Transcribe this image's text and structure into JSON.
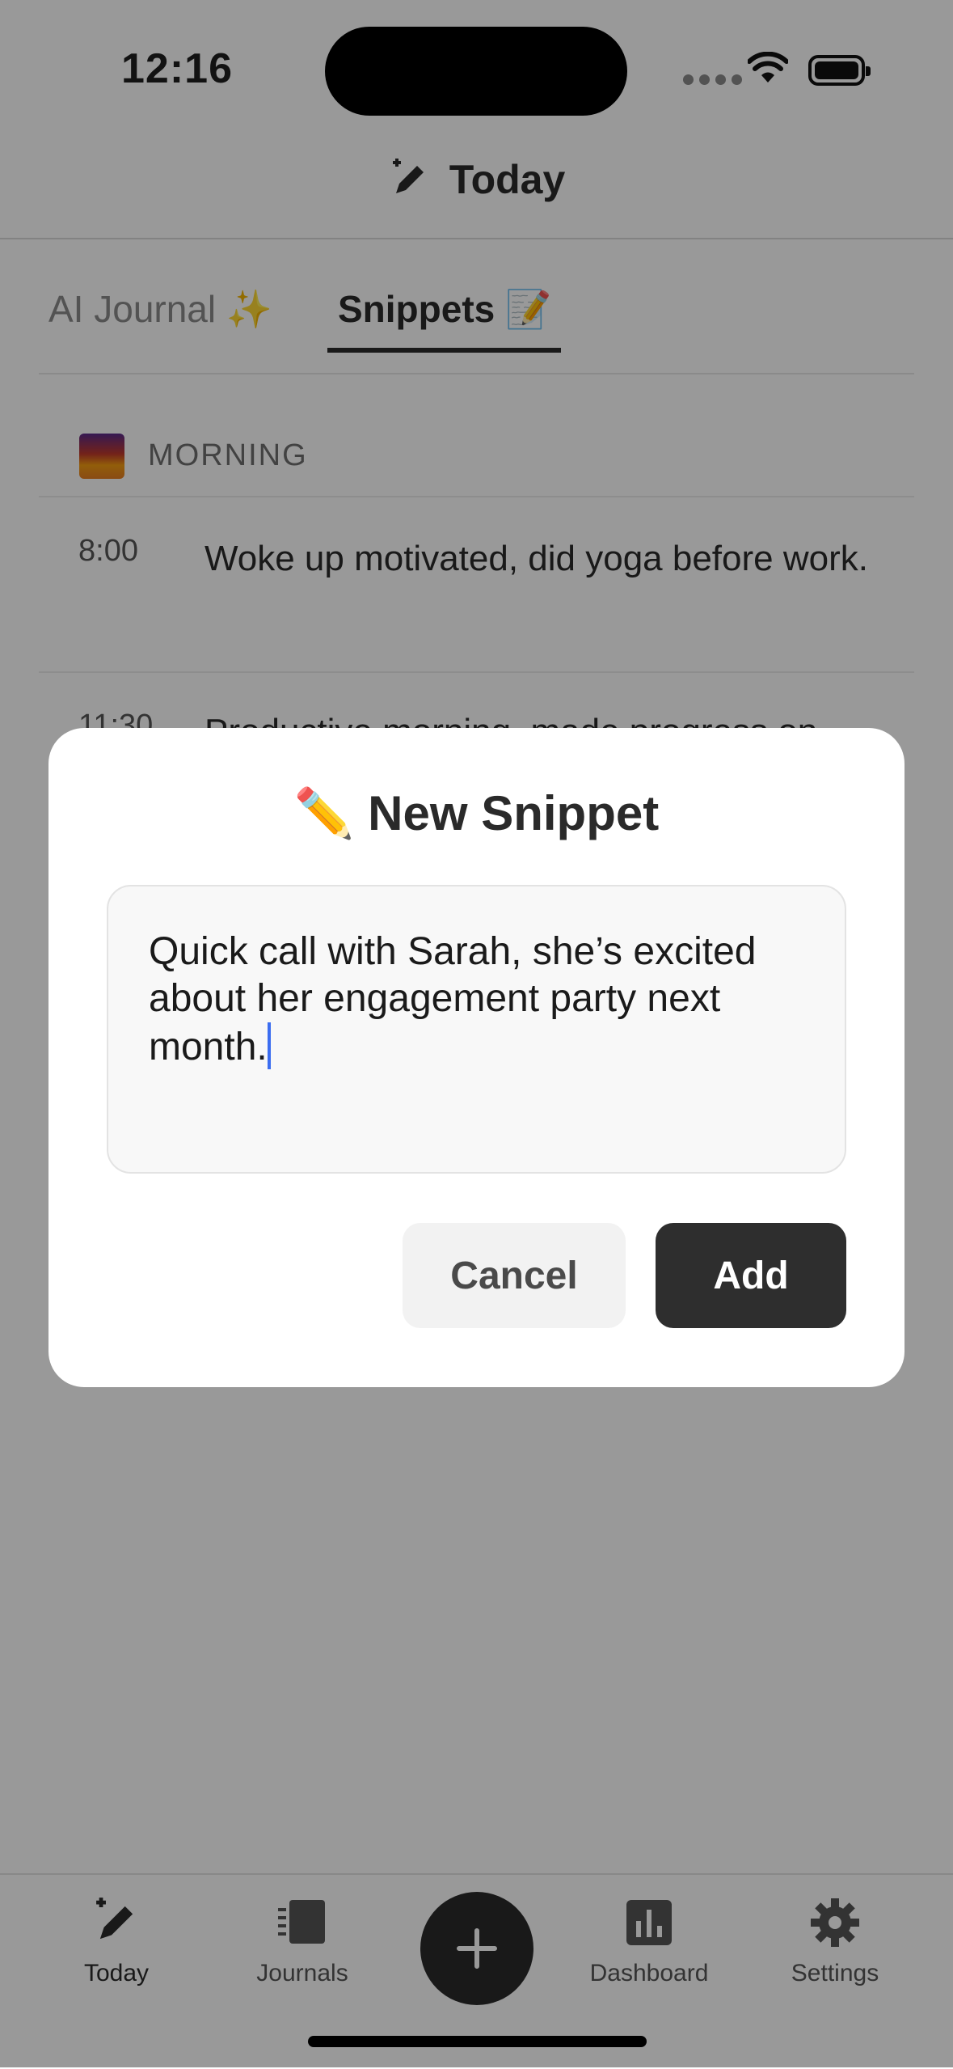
{
  "status_bar": {
    "time": "12:16"
  },
  "header": {
    "title": "Today",
    "icon": "edit-pen-sparkle-icon"
  },
  "tabs": [
    {
      "label": "AI Journal ✨",
      "active": false
    },
    {
      "label": "Snippets 📝",
      "active": true
    }
  ],
  "section": {
    "title": "MORNING",
    "icon": "sunrise-icon"
  },
  "entries": [
    {
      "time": "8:00",
      "text": "Woke up motivated, did yoga before work."
    },
    {
      "time": "11:30",
      "text": "Productive morning, made progress on"
    }
  ],
  "dialog": {
    "title": "✏️ New Snippet",
    "input_value": "Quick call with Sarah, she’s excited about her engagement party next month.",
    "cancel_label": "Cancel",
    "add_label": "Add"
  },
  "nav": {
    "items": [
      {
        "label": "Today",
        "icon": "edit-pen-sparkle-icon",
        "active": true
      },
      {
        "label": "Journals",
        "icon": "journals-icon",
        "active": false
      },
      {
        "label": "Dashboard",
        "icon": "bar-chart-icon",
        "active": false
      },
      {
        "label": "Settings",
        "icon": "gear-icon",
        "active": false
      }
    ],
    "fab_icon": "plus-icon"
  },
  "colors": {
    "accent": "#2e2e2e",
    "caret": "#3b6df0",
    "overlay": "rgba(0,0,0,0.4)"
  }
}
